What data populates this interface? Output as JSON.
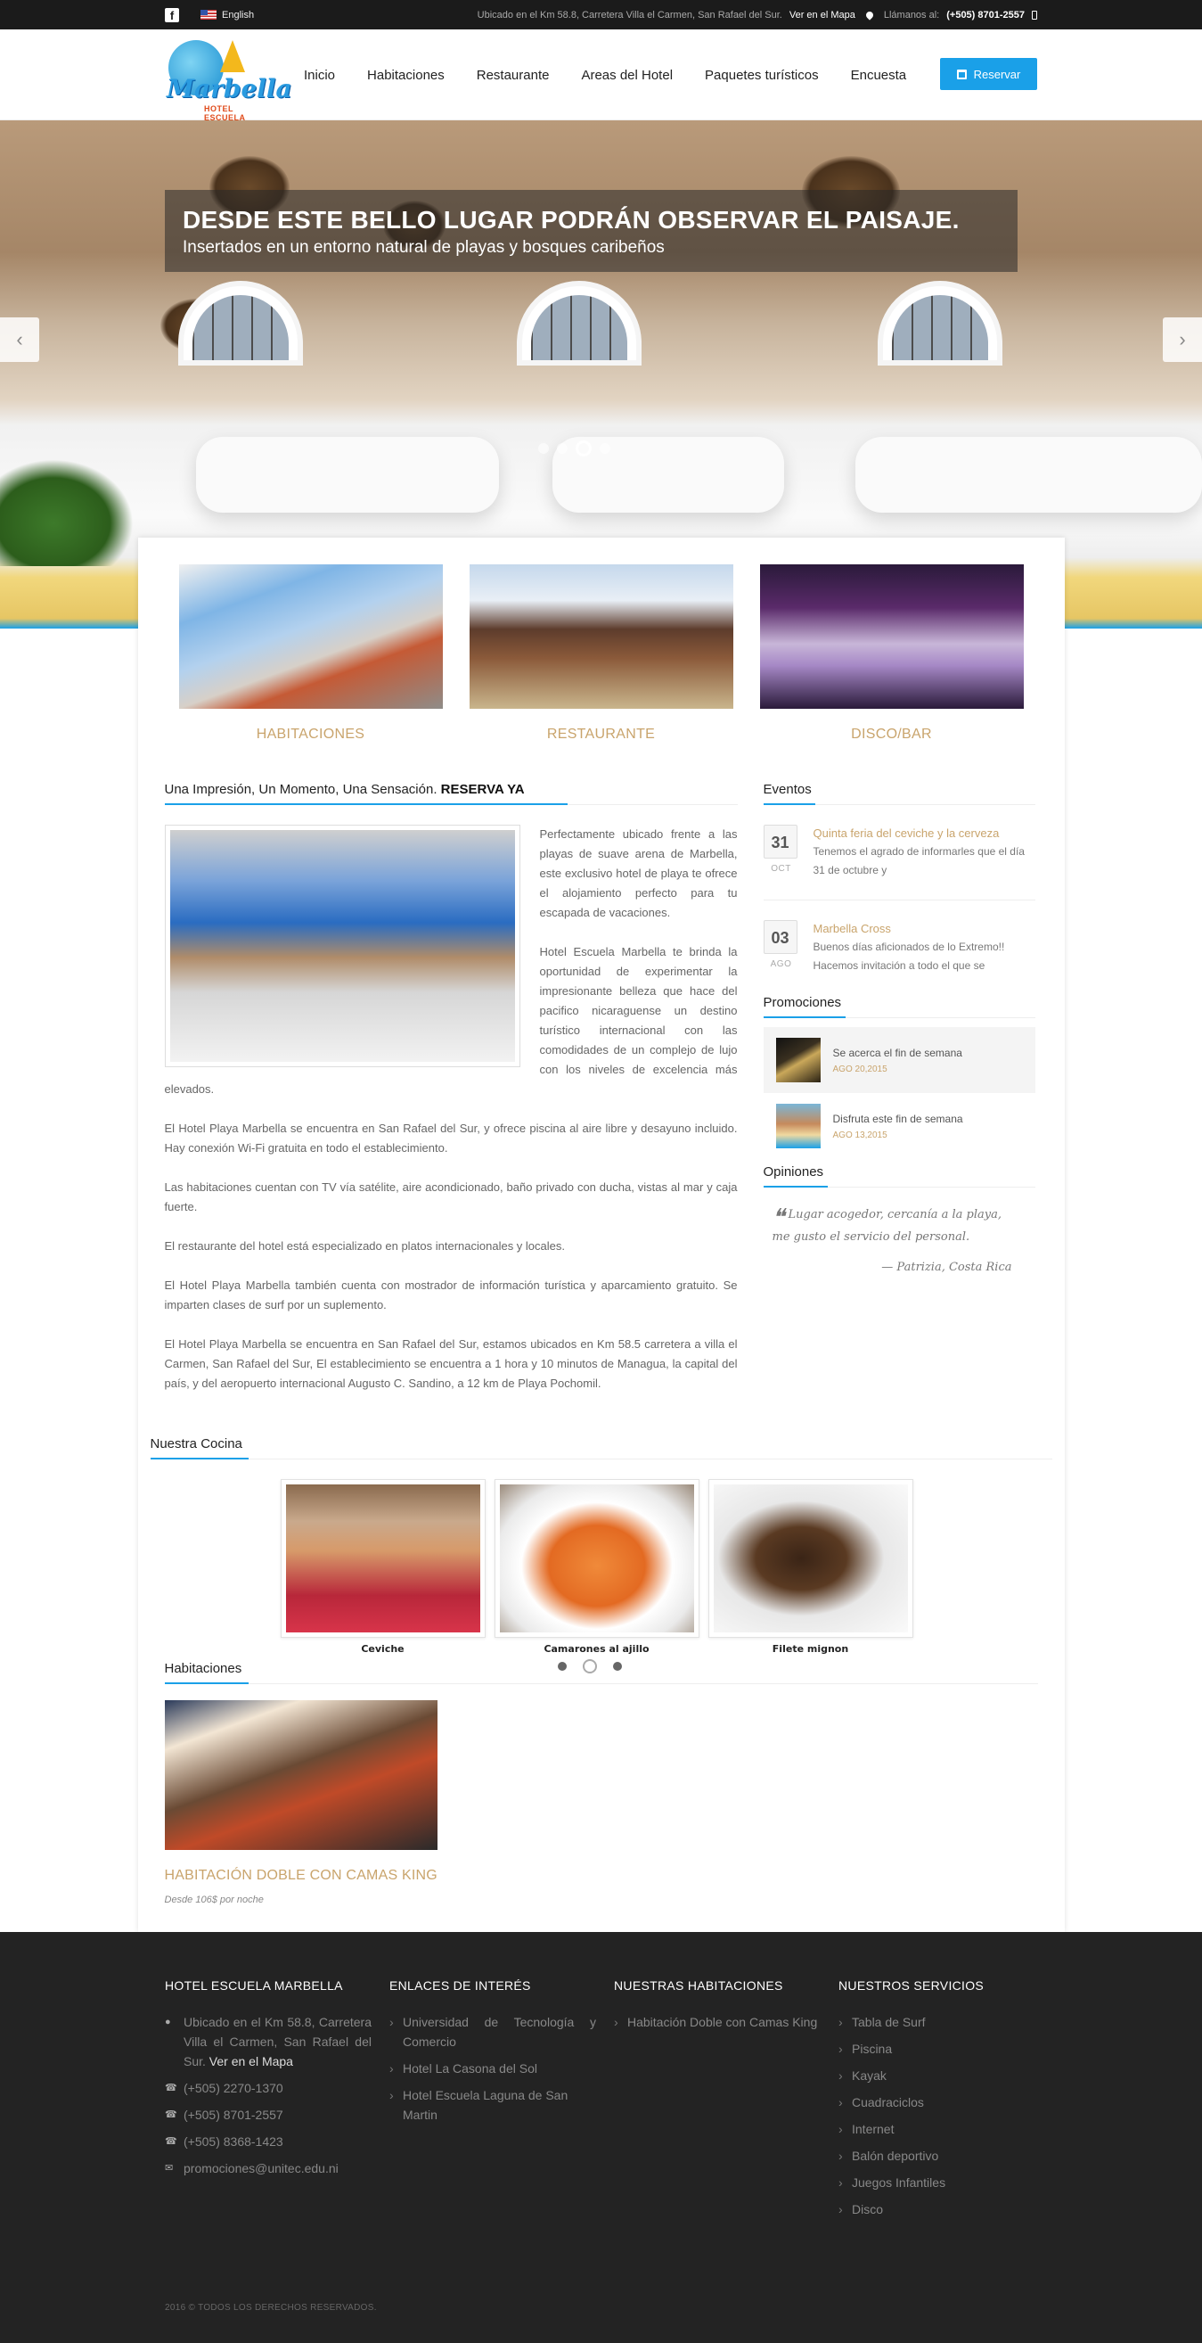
{
  "topbar": {
    "facebook_icon": "facebook-icon",
    "language": "English",
    "address": "Ubicado en el Km 58.8, Carretera Villa el Carmen, San Rafael del Sur.",
    "map_link": "Ver en el Mapa",
    "call_label": "Llámanos al:",
    "phone": "(+505) 8701-2557"
  },
  "header": {
    "logo_text": "Marbella",
    "logo_sub": "HOTEL ESCUELA",
    "nav": [
      "Inicio",
      "Habitaciones",
      "Restaurante",
      "Areas del Hotel",
      "Paquetes turísticos",
      "Encuesta"
    ],
    "reserve_label": "Reservar"
  },
  "hero": {
    "title": "DESDE ESTE BELLO LUGAR PODRÁN OBSERVAR EL PAISAJE.",
    "subtitle": "Insertados en un entorno natural de playas y bosques caribeños",
    "prev_arrow": "‹",
    "next_arrow": "›",
    "slides": 4,
    "active_slide": 3
  },
  "features": [
    {
      "label": "HABITACIONES"
    },
    {
      "label": "RESTAURANTE"
    },
    {
      "label": "DISCO/BAR"
    }
  ],
  "intro": {
    "title_plain": "Una Impresión, Un Momento, Una Sensación.",
    "title_bold": "RESERVA YA",
    "p1": "Perfectamente ubicado frente a las playas de suave arena de Marbella, este exclusivo hotel de playa te ofrece el alojamiento perfecto para tu escapada de vacaciones.",
    "p2": "Hotel Escuela Marbella te brinda la oportunidad de experimentar la impresionante belleza que hace del pacifico nicaraguense un destino turístico internacional con las comodidades de un complejo de lujo con los niveles de excelencia más elevados.",
    "p3": "El Hotel Playa Marbella se encuentra en San Rafael del Sur, y ofrece piscina al aire libre y desayuno incluido. Hay conexión Wi-Fi gratuita en todo el establecimiento.",
    "p4": "Las habitaciones cuentan con TV vía satélite, aire acondicionado, baño privado con ducha, vistas al mar y caja fuerte.",
    "p5": "El restaurante del hotel está especializado en platos internacionales y locales.",
    "p6": "El Hotel Playa Marbella también cuenta con mostrador de información turística y aparcamiento gratuito. Se imparten clases de surf por un suplemento.",
    "p7": "El Hotel Playa Marbella se encuentra en San Rafael del Sur, estamos ubicados en Km 58.5 carretera a villa el Carmen, San Rafael del Sur, El establecimiento se encuentra a 1 hora y 10 minutos de Managua, la capital del país, y del aeropuerto internacional Augusto C. Sandino, a 12 km de Playa Pochomil."
  },
  "events": {
    "title": "Eventos",
    "items": [
      {
        "day": "31",
        "month": "OCT",
        "title": "Quinta feria del ceviche y la cerveza",
        "text": "Tenemos el agrado de informarles que el día 31 de octubre y"
      },
      {
        "day": "03",
        "month": "AGO",
        "title": "Marbella Cross",
        "text": "Buenos días aficionados de lo Extremo!! Hacemos invitación a todo el que se"
      }
    ]
  },
  "promotions": {
    "title": "Promociones",
    "items": [
      {
        "title": "Se acerca el fin de semana",
        "date": "AGO 20,2015"
      },
      {
        "title": "Disfruta este fin de semana",
        "date": "AGO 13,2015"
      }
    ]
  },
  "opinions": {
    "title": "Opiniones",
    "quote": "Lugar acogedor, cercanía a la playa, me gusto el servicio del personal.",
    "author": "— Patrizia, Costa Rica"
  },
  "cocina": {
    "title": "Nuestra Cocina",
    "dishes": [
      "Ceviche",
      "Camarones al ajillo",
      "Filete mignon"
    ],
    "pages": 3,
    "active_page": 2
  },
  "habitaciones": {
    "title": "Habitaciones",
    "room_name": "HABITACIÓN DOBLE CON CAMAS KING",
    "room_price": "Desde 106$ por noche"
  },
  "footer": {
    "col1": {
      "title": "HOTEL ESCUELA MARBELLA",
      "address": "Ubicado en el Km 58.8, Carretera Villa el Carmen, San Rafael del Sur.",
      "map_link": "Ver en el Mapa",
      "phone1": "(+505) 2270-1370",
      "phone2": "(+505) 8701-2557",
      "phone3": "(+505) 8368-1423",
      "email": "promociones@unitec.edu.ni"
    },
    "col2": {
      "title": "ENLACES DE INTERÉS",
      "links": [
        "Universidad de Tecnología y Comercio",
        "Hotel La Casona del Sol",
        "Hotel Escuela Laguna de San Martin"
      ]
    },
    "col3": {
      "title": "NUESTRAS HABITACIONES",
      "links": [
        "Habitación Doble con Camas King"
      ]
    },
    "col4": {
      "title": "NUESTROS SERVICIOS",
      "links": [
        "Tabla de Surf",
        "Piscina",
        "Kayak",
        "Cuadraciclos",
        "Internet",
        "Balón deportivo",
        "Juegos Infantiles",
        "Disco"
      ]
    },
    "copyright": "2016 © TODOS LOS DERECHOS RESERVADOS."
  },
  "colors": {
    "accent_blue": "#1aa0e8",
    "gold": "#c9a46c",
    "topbar_bg": "#1b1b1b",
    "footer_bg": "#232323"
  }
}
